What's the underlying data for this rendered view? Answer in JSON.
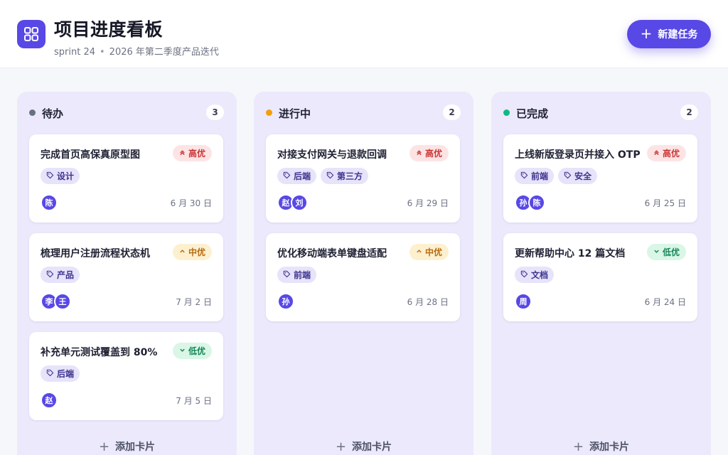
{
  "header": {
    "title": "项目进度看板",
    "sprint": "sprint 24",
    "separator": "•",
    "subtitle": "2026 年第二季度产品迭代",
    "new_task_label": "新建任务",
    "logo_icon": "grid-icon",
    "accent_color": "#5848e6"
  },
  "columns": [
    {
      "title": "待办",
      "count": "3",
      "dot_color": "#677183",
      "add_label": "添加卡片",
      "cards": [
        {
          "title": "完成首页高保真原型图",
          "priority": "高优",
          "priority_level": "high",
          "tags": [
            "设计"
          ],
          "assignees": [
            "陈"
          ],
          "due": "6 月 30 日"
        },
        {
          "title": "梳理用户注册流程状态机",
          "priority": "中优",
          "priority_level": "mid",
          "tags": [
            "产品"
          ],
          "assignees": [
            "李",
            "王"
          ],
          "due": "7 月 2 日"
        },
        {
          "title": "补充单元测试覆盖到 80%",
          "priority": "低优",
          "priority_level": "low",
          "tags": [
            "后端"
          ],
          "assignees": [
            "赵"
          ],
          "due": "7 月 5 日"
        }
      ]
    },
    {
      "title": "进行中",
      "count": "2",
      "dot_color": "#f59e0b",
      "add_label": "添加卡片",
      "cards": [
        {
          "title": "对接支付网关与退款回调",
          "priority": "高优",
          "priority_level": "high",
          "tags": [
            "后端",
            "第三方"
          ],
          "assignees": [
            "赵",
            "刘"
          ],
          "due": "6 月 29 日"
        },
        {
          "title": "优化移动端表单键盘适配",
          "priority": "中优",
          "priority_level": "mid",
          "tags": [
            "前端"
          ],
          "assignees": [
            "孙"
          ],
          "due": "6 月 28 日"
        }
      ]
    },
    {
      "title": "已完成",
      "count": "2",
      "dot_color": "#10b981",
      "add_label": "添加卡片",
      "cards": [
        {
          "title": "上线新版登录页并接入 OTP",
          "priority": "高优",
          "priority_level": "high",
          "tags": [
            "前端",
            "安全"
          ],
          "assignees": [
            "孙",
            "陈"
          ],
          "due": "6 月 25 日"
        },
        {
          "title": "更新帮助中心 12 篇文档",
          "priority": "低优",
          "priority_level": "low",
          "tags": [
            "文档"
          ],
          "assignees": [
            "周"
          ],
          "due": "6 月 24 日"
        }
      ]
    }
  ],
  "icons": {
    "tag": "tag-icon",
    "priority_high": "chevrons-up-icon",
    "priority_mid": "chevron-up-icon",
    "priority_low": "chevron-down-icon",
    "add": "plus-icon"
  }
}
